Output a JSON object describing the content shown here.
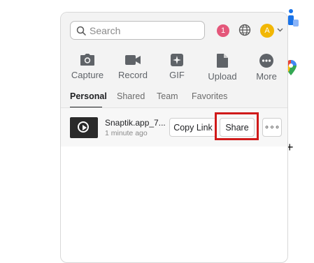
{
  "search": {
    "placeholder": "Search"
  },
  "header": {
    "notification_count": "1",
    "avatar_initial": "A"
  },
  "tools": [
    {
      "label": "Capture",
      "icon": "camera-icon"
    },
    {
      "label": "Record",
      "icon": "video-camera-icon"
    },
    {
      "label": "GIF",
      "icon": "sparkle-icon"
    },
    {
      "label": "Upload",
      "icon": "file-icon"
    },
    {
      "label": "More",
      "icon": "more-icon"
    }
  ],
  "tabs": [
    "Personal",
    "Shared",
    "Team",
    "Favorites"
  ],
  "item": {
    "name": "Snaptik.app_7...",
    "time": "1 minute ago",
    "copy_link": "Copy Link",
    "share": "Share",
    "more": "∘∘∘"
  },
  "colors": {
    "badge": "#e4577a",
    "avatar": "#f2b705",
    "highlight": "#d01a1a"
  }
}
